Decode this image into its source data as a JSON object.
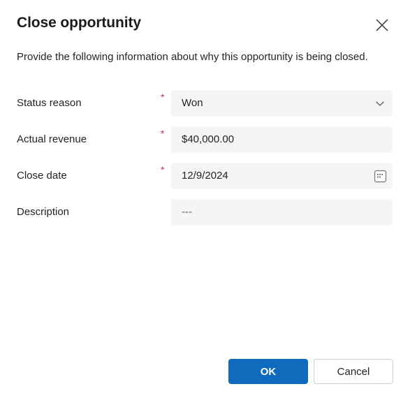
{
  "dialog": {
    "title": "Close opportunity",
    "subtitle": "Provide the following information about why this opportunity is being closed.",
    "close_icon": "close-icon",
    "close_label": "Close"
  },
  "form": {
    "fields": [
      {
        "label": "Status reason",
        "required": true,
        "required_marker": "*",
        "value": "Won",
        "affordance": "chevron-down-icon",
        "is_placeholder": false
      },
      {
        "label": "Actual revenue",
        "required": true,
        "required_marker": "*",
        "value": "$40,000.00",
        "affordance": "",
        "is_placeholder": false
      },
      {
        "label": "Close date",
        "required": true,
        "required_marker": "*",
        "value": "12/9/2024",
        "affordance": "calendar-icon",
        "is_placeholder": false
      },
      {
        "label": "Description",
        "required": false,
        "required_marker": "",
        "value": "---",
        "affordance": "",
        "is_placeholder": true
      }
    ]
  },
  "footer": {
    "ok_label": "OK",
    "cancel_label": "Cancel"
  },
  "colors": {
    "accent": "#0f6cbd",
    "required": "#c4314b",
    "field_background": "#f5f5f5",
    "text": "#242424",
    "border": "#d1d1d1"
  }
}
